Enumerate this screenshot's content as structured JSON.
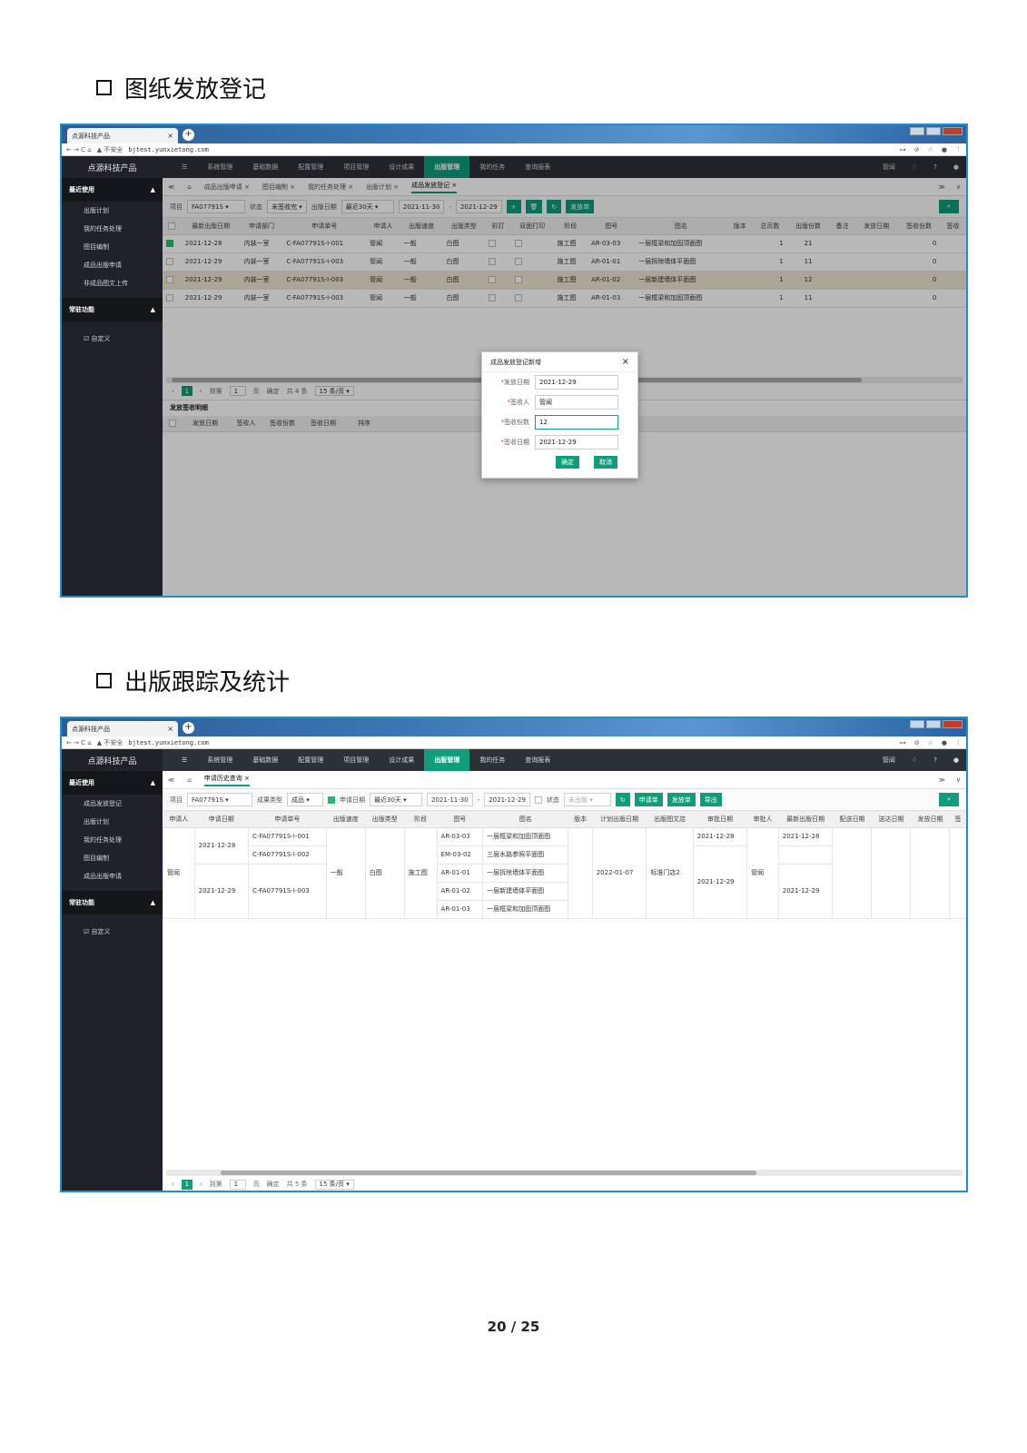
{
  "section1": {
    "title": "图纸发放登记"
  },
  "section2": {
    "title": "出版跟踪及统计"
  },
  "page_number": "20 / 25",
  "browser": {
    "tab_title": "点源科技产品",
    "tab_close": "×",
    "new_tab": "+",
    "nav_glyphs": "← → C ⌂",
    "insecure": "▲ 不安全",
    "url": "bjtest.yunxietong.com",
    "tools": [
      "⊶",
      "⊘",
      "☆",
      "●",
      "⋮"
    ]
  },
  "app": {
    "brand": "点源科技产品",
    "topnav": [
      "☰",
      "系统管理",
      "基础数据",
      "配置管理",
      "项目管理",
      "设计成果",
      "出版管理",
      "我的任务",
      "查询报表"
    ],
    "topnav_active": "出版管理",
    "topnav_right": [
      "管闻",
      "♢",
      "?",
      "●"
    ],
    "sidebar_recent_title": "最近使用",
    "sidebar_common_title": "常驻功能",
    "sidebar_custom": "☑ 自定义",
    "caret": "▲"
  },
  "screen1": {
    "sidebar_items": [
      "出版计划",
      "我的任务处理",
      "图目编制",
      "成品出版申请",
      "非成品图文上传"
    ],
    "tabs": [
      "≪",
      "⌂",
      "成品出版申请 ×",
      "图目编制 ×",
      "我的任务处理 ×",
      "出版计划 ×",
      "成品发放登记 ×"
    ],
    "active_tab": "成品发放登记 ×",
    "tab_right": [
      "≫",
      "∨"
    ],
    "filter": {
      "project_label": "项目",
      "project": "FA07791S ▾",
      "status_label": "状态",
      "status": "未签收完 ▾",
      "date_label": "出版日期",
      "range": "最近30天 ▾",
      "from": "2021-11-30",
      "dash": "-",
      "to": "2021-12-29",
      "btn_add": "+",
      "btn_del": "🗑",
      "btn_refresh": "↻",
      "btn_issue": "发放单",
      "search": "⌕"
    },
    "columns": [
      "",
      "最新出版日期",
      "申请部门",
      "申请单号",
      "申请人",
      "出版速度",
      "出版类型",
      "彩打",
      "双面打印",
      "阶段",
      "图号",
      "图名",
      "版本",
      "总页数",
      "出版份数",
      "备注",
      "发放日期",
      "签收份数",
      "签收"
    ],
    "rows": [
      {
        "checked": true,
        "date": "2021-12-28",
        "dept": "内装一室",
        "no": "C-FA07791S-I-001",
        "person": "管闻",
        "speed": "一般",
        "type": "白图",
        "stage": "施工图",
        "drawing": "AR-03-03",
        "name": "一层框梁和加固顶面图",
        "pages": "1",
        "copies": "21",
        "signed": "0"
      },
      {
        "checked": false,
        "date": "2021-12-29",
        "dept": "内装一室",
        "no": "C-FA07791S-I-003",
        "person": "管闻",
        "speed": "一般",
        "type": "白图",
        "stage": "施工图",
        "drawing": "AR-01-01",
        "name": "一层拆除墙体平面图",
        "pages": "1",
        "copies": "11",
        "signed": "0"
      },
      {
        "checked": false,
        "date": "2021-12-29",
        "dept": "内装一室",
        "no": "C-FA07791S-I-003",
        "person": "管闻",
        "speed": "一般",
        "type": "白图",
        "stage": "施工图",
        "drawing": "AR-01-02",
        "name": "一层新建墙体平面图",
        "pages": "1",
        "copies": "12",
        "signed": "0"
      },
      {
        "checked": false,
        "date": "2021-12-29",
        "dept": "内装一室",
        "no": "C-FA07791S-I-003",
        "person": "管闻",
        "speed": "一般",
        "type": "白图",
        "stage": "施工图",
        "drawing": "AR-01-03",
        "name": "一层框梁和加固顶面图",
        "pages": "1",
        "copies": "11",
        "signed": "0"
      }
    ],
    "pager": {
      "prev": "‹",
      "page": "1",
      "next": "›",
      "goto": "到第",
      "page_input": "1",
      "page_unit": "页",
      "confirm": "确定",
      "total": "共 4 条",
      "size": "15 条/页 ▾"
    },
    "detail_title": "发放签收明细",
    "detail_columns": [
      "",
      "发放日期",
      "签收人",
      "签收份数",
      "签收日期",
      "排序"
    ],
    "dialog": {
      "title": "成品发放登记新增",
      "close": "×",
      "fields": [
        {
          "label": "发放日期",
          "value": "2021-12-29"
        },
        {
          "label": "签收人",
          "value": "管闻"
        },
        {
          "label": "签收份数",
          "value": "12"
        },
        {
          "label": "签收日期",
          "value": "2021-12-29"
        }
      ],
      "required_mark": "*",
      "ok": "确定",
      "cancel": "取消"
    }
  },
  "screen2": {
    "sidebar_items": [
      "成品发放登记",
      "出版计划",
      "我的任务处理",
      "图目编制",
      "成品出版申请"
    ],
    "tabs": [
      "≪",
      "⌂",
      "申请历史查询 ×"
    ],
    "active_tab": "申请历史查询 ×",
    "tab_right": [
      "≫",
      "∨"
    ],
    "filter": {
      "project_label": "项目",
      "project": "FA07791S ▾",
      "type_label": "成果类型",
      "type": "成品 ▾",
      "date_label": "申请日期",
      "range": "最近30天 ▾",
      "from": "2021-11-30",
      "dash": "-",
      "to": "2021-12-29",
      "status_label": "状态",
      "status": "未出版 ▾",
      "btn_refresh": "↻",
      "btn_apply": "申请单",
      "btn_issue": "发放单",
      "btn_export": "导出",
      "search": "⌕"
    },
    "columns": [
      "申请人",
      "申请日期",
      "申请单号",
      "出版速度",
      "出版类型",
      "阶段",
      "图号",
      "图名",
      "版本",
      "计划出版日期",
      "出版图文店",
      "审批日期",
      "审批人",
      "最新出版日期",
      "配送日期",
      "送达日期",
      "发放日期",
      "签"
    ],
    "person": "管闻",
    "date1": "2021-12-28",
    "date2": "2021-12-29",
    "no1": "C-FA07791S-I-001",
    "no2": "C-FA07791S-I-002",
    "no3": "C-FA07791S-I-003",
    "speed": "一般",
    "type": "白图",
    "stage": "施工图",
    "drawings": [
      {
        "no": "AR-03-03",
        "name": "一层框梁和加固顶面图"
      },
      {
        "no": "EM-03-02",
        "name": "三层水路参照平面图"
      },
      {
        "no": "AR-01-01",
        "name": "一层拆除墙体平面图"
      },
      {
        "no": "AR-01-02",
        "name": "一层新建墙体平面图"
      },
      {
        "no": "AR-01-03",
        "name": "一层框梁和加固顶面图"
      }
    ],
    "plan_date": "2022-01-07",
    "shop": "标准门店2",
    "approve1": "2021-12-28",
    "approve2": "2021-12-29",
    "approver": "管闻",
    "latest1": "2021-12-28",
    "latest2": "2021-12-29",
    "pager": {
      "prev": "‹",
      "page": "1",
      "next": "›",
      "goto": "到第",
      "page_input": "1",
      "page_unit": "页",
      "confirm": "确定",
      "total": "共 5 条",
      "size": "15 条/页 ▾"
    }
  }
}
